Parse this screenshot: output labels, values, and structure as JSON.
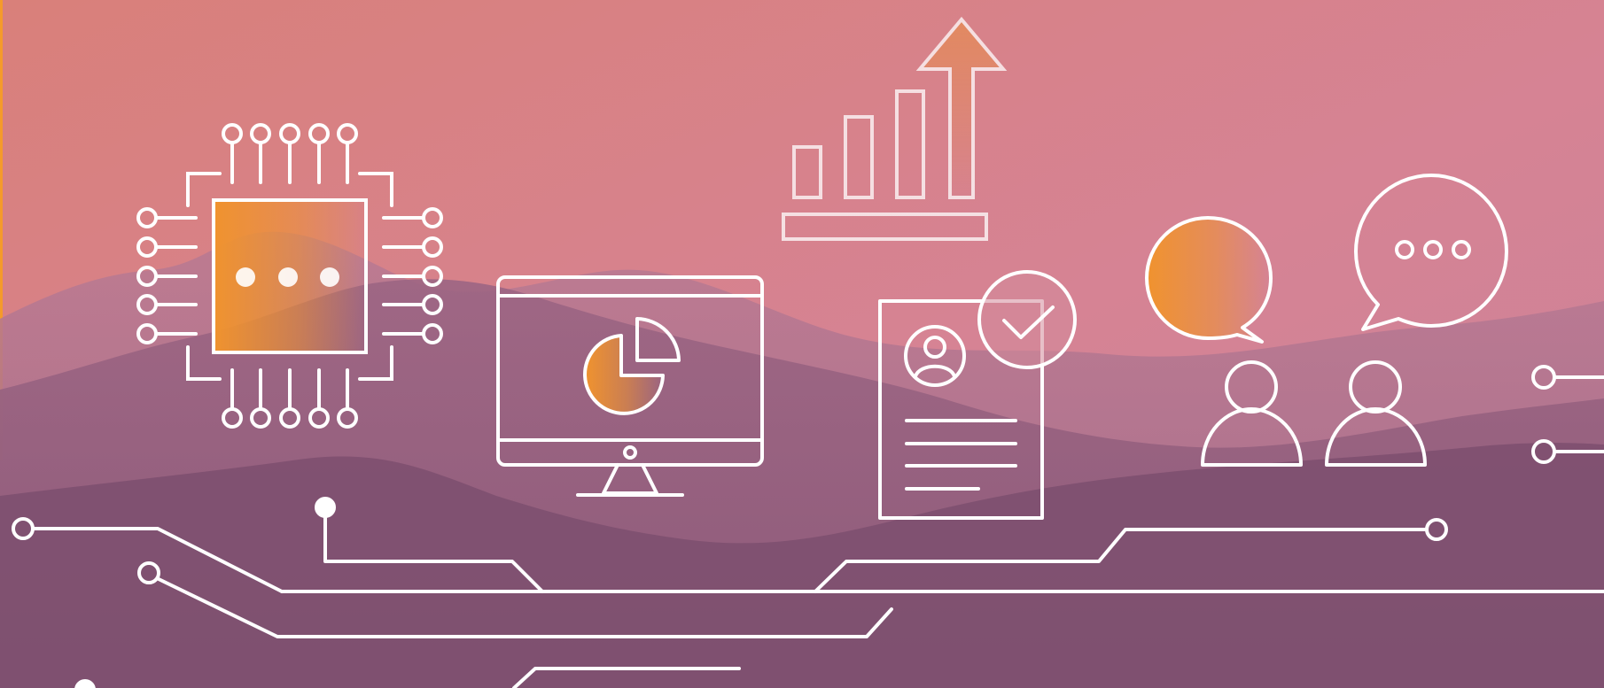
{
  "palette": {
    "sky_top": "#d9807a",
    "sky_mid": "#d68394",
    "sky_bottom": "#c9829a",
    "mountain_far": "#b97a93",
    "mountain_mid": "#9c6583",
    "mountain_near": "#7d4f6e",
    "line_color": "#ffffff",
    "accent_orange": "#f0932e",
    "accent_strip": "#f59a2b"
  },
  "icons": [
    "cpu-chip-icon",
    "bar-chart-growth-icon",
    "monitor-pie-chart-icon",
    "document-profile-check-icon",
    "chat-bubble-icon",
    "chat-bubble-typing-icon",
    "user-icon",
    "user-icon",
    "circuit-lines"
  ]
}
